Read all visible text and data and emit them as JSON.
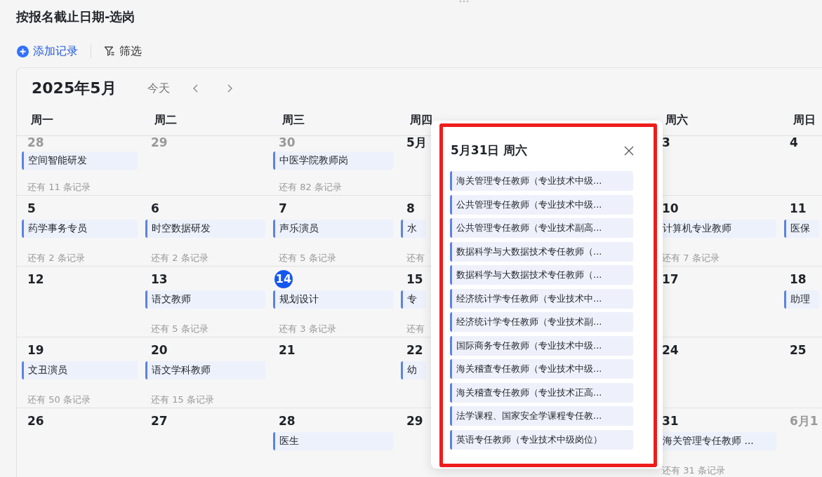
{
  "view_title": "按报名截止日期-选岗",
  "toolbar": {
    "add_label": "添加记录",
    "filter_label": "筛选"
  },
  "calendar": {
    "month_title": "2025年5月",
    "today_label": "今天",
    "weekdays": [
      {
        "label": "周一"
      },
      {
        "label": "周二"
      },
      {
        "label": "周三"
      },
      {
        "label": "周四"
      },
      {
        "label": "周六"
      },
      {
        "label": "周日"
      }
    ],
    "weeks": [
      {
        "days": [
          {
            "date": "28",
            "other_month": true,
            "today": false,
            "events": [
              "空间智能研发"
            ],
            "more": "还有 11 条记录"
          },
          {
            "date": "29",
            "other_month": true,
            "today": false
          },
          {
            "date": "30",
            "other_month": true,
            "today": false,
            "events": [
              "中医学院教师岗"
            ],
            "more": "还有 82 条记录"
          },
          {
            "date": "5月",
            "other_month": false,
            "today": false
          },
          {
            "date": "3",
            "other_month": false,
            "today": false
          },
          {
            "date": "4",
            "other_month": false,
            "today": false
          }
        ]
      },
      {
        "days": [
          {
            "date": "5",
            "other_month": false,
            "today": false,
            "events": [
              "药学事务专员"
            ],
            "more": "还有 2 条记录"
          },
          {
            "date": "6",
            "other_month": false,
            "today": false,
            "events": [
              "时空数据研发"
            ],
            "more": "还有 2 条记录"
          },
          {
            "date": "7",
            "other_month": false,
            "today": false,
            "events": [
              "声乐演员"
            ],
            "more": "还有 5 条记录"
          },
          {
            "date": "8",
            "other_month": false,
            "today": false,
            "events": [
              "水"
            ],
            "more": "还有"
          },
          {
            "date": "10",
            "other_month": false,
            "today": false,
            "events": [
              "计算机专业教师"
            ],
            "more": "还有 7 条记录"
          },
          {
            "date": "11",
            "other_month": false,
            "today": false,
            "events": [
              "医保"
            ]
          }
        ]
      },
      {
        "days": [
          {
            "date": "12",
            "other_month": false,
            "today": false
          },
          {
            "date": "13",
            "other_month": false,
            "today": false,
            "events": [
              "语文教师"
            ],
            "more": "还有 5 条记录"
          },
          {
            "date": "14",
            "other_month": false,
            "today": true,
            "events": [
              "规划设计"
            ],
            "more": "还有 3 条记录"
          },
          {
            "date": "15",
            "other_month": false,
            "today": false,
            "events": [
              "专"
            ],
            "more": "还有"
          },
          {
            "date": "17",
            "other_month": false,
            "today": false
          },
          {
            "date": "18",
            "other_month": false,
            "today": false,
            "events": [
              "助理"
            ]
          }
        ]
      },
      {
        "days": [
          {
            "date": "19",
            "other_month": false,
            "today": false,
            "events": [
              "文丑演员"
            ],
            "more": "还有 50 条记录"
          },
          {
            "date": "20",
            "other_month": false,
            "today": false,
            "events": [
              "语文学科教师"
            ],
            "more": "还有 15 条记录"
          },
          {
            "date": "21",
            "other_month": false,
            "today": false
          },
          {
            "date": "22",
            "other_month": false,
            "today": false,
            "events": [
              "幼"
            ]
          },
          {
            "date": "24",
            "other_month": false,
            "today": false
          },
          {
            "date": "25",
            "other_month": false,
            "today": false
          }
        ]
      },
      {
        "days": [
          {
            "date": "26",
            "other_month": false,
            "today": false
          },
          {
            "date": "27",
            "other_month": false,
            "today": false
          },
          {
            "date": "28",
            "other_month": false,
            "today": false,
            "events": [
              "医生"
            ]
          },
          {
            "date": "29",
            "other_month": false,
            "today": false
          },
          {
            "date": "31",
            "other_month": false,
            "today": false,
            "events": [
              "海关管理专任教师 ..."
            ],
            "more": "还有 31 条记录"
          },
          {
            "date": "6月1",
            "other_month": true,
            "today": false
          }
        ]
      }
    ]
  },
  "day_popup": {
    "title": "5月31日 周六",
    "items": [
      "海关管理专任教师（专业技术中级...",
      "公共管理专任教师（专业技术中级...",
      "公共管理专任教师（专业技术副高...",
      "数据科学与大数据技术专任教师（...",
      "数据科学与大数据技术专任教师（...",
      "经济统计学专任教师（专业技术中...",
      "经济统计学专任教师（专业技术副...",
      "国际商务专任教师（专业技术中级...",
      "海关稽查专任教师（专业技术中级...",
      "海关稽查专任教师（专业技术正高...",
      "法学课程、国家安全学课程专任教...",
      "英语专任教师（专业技术中级岗位）"
    ]
  }
}
